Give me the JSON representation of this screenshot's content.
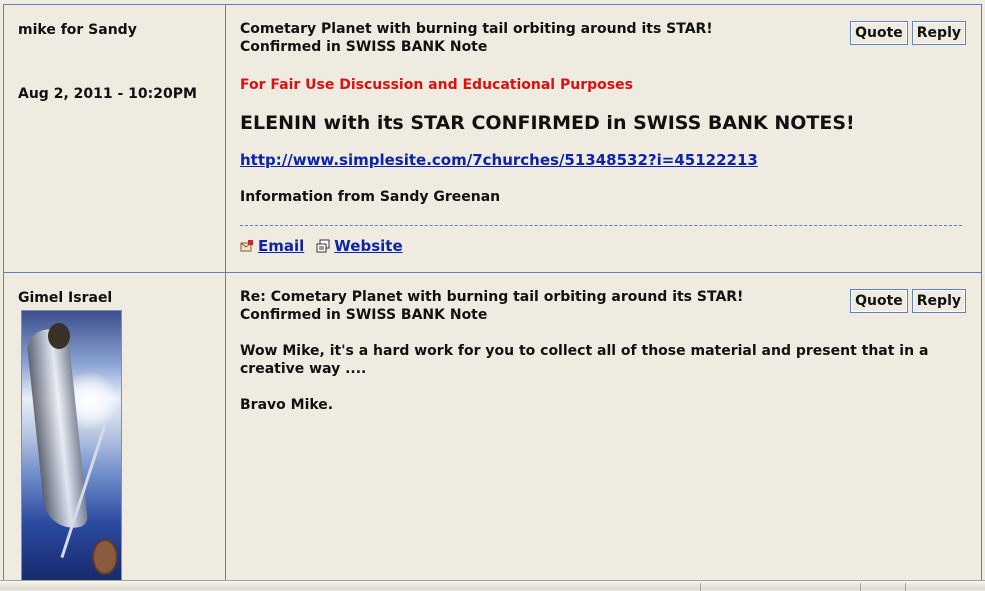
{
  "posts": [
    {
      "author": "mike for Sandy",
      "date": "Aug 2, 2011 - 10:20PM",
      "title": "Cometary Planet with burning tail orbiting around its STAR! Confirmed in SWISS BANK Note",
      "quote_label": "Quote",
      "reply_label": "Reply",
      "disclaimer": "For Fair Use Discussion and Educational Purposes",
      "headline": "ELENIN with its STAR CONFIRMED in SWISS BANK NOTES!",
      "link": "http://www.simplesite.com/7churches/51348532?i=45122213",
      "info": "Information from Sandy Greenan",
      "email_label": "Email",
      "website_label": "Website"
    },
    {
      "author": "Gimel Israel",
      "title": "Re: Cometary Planet with burning tail orbiting around its STAR! Confirmed in SWISS BANK Note",
      "quote_label": "Quote",
      "reply_label": "Reply",
      "body": "Wow Mike, it's a hard work for you to collect all of those material and present that in a creative way ....",
      "sign": "Bravo Mike."
    }
  ],
  "icons": {
    "email": "email-icon",
    "website": "website-icon",
    "avatar": "avatar-image"
  },
  "colors": {
    "background": "#efebe0",
    "border": "#5d82c3",
    "disclaimer": "#dd1010",
    "link": "#0b24a8"
  }
}
